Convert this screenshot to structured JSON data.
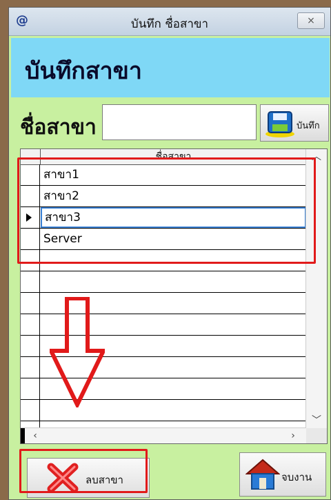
{
  "window": {
    "app_icon": "@",
    "title": "บันทึก ชื่อสาขา",
    "close_label": "⨯"
  },
  "header": {
    "title": "บันทึกสาขา"
  },
  "form": {
    "name_label": "ชื่อสาขา",
    "name_value": "",
    "save_label": "บันทึก",
    "save_icon": "floppy-disk-icon"
  },
  "grid": {
    "column_header": "ชื่อสาขา",
    "rows": [
      "สาขา1",
      "สาขา2",
      "สาขา3",
      "Server",
      "",
      "",
      "",
      "",
      "",
      "",
      "",
      "",
      ""
    ],
    "current_row": 3
  },
  "buttons": {
    "delete_label": "ลบสาขา",
    "delete_icon": "red-x-icon",
    "exit_label": "จบงาน",
    "exit_icon": "house-icon"
  },
  "colors": {
    "window_bg": "#c8f0a0",
    "header_band": "#7fd8f6",
    "annotation": "#e11a1a"
  }
}
